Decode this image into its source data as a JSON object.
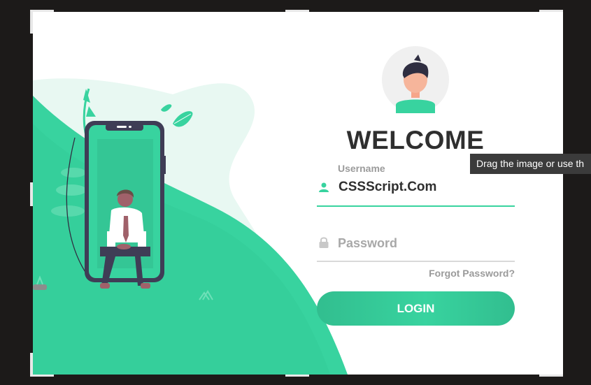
{
  "login": {
    "title": "WELCOME",
    "username_label": "Username",
    "username_value": "CSSScript.Com",
    "password_placeholder": "Password",
    "forgot_link": "Forgot Password?",
    "login_button": "LOGIN"
  },
  "tooltip": {
    "text": "Drag the image or use th"
  },
  "icons": {
    "user": "user-icon",
    "lock": "lock-icon",
    "avatar": "avatar-icon"
  },
  "colors": {
    "accent": "#38d39f",
    "accent_dark": "#32be8f",
    "backdrop": "#1c1a19",
    "text": "#2f2f2f",
    "muted": "#9b9b9b"
  }
}
